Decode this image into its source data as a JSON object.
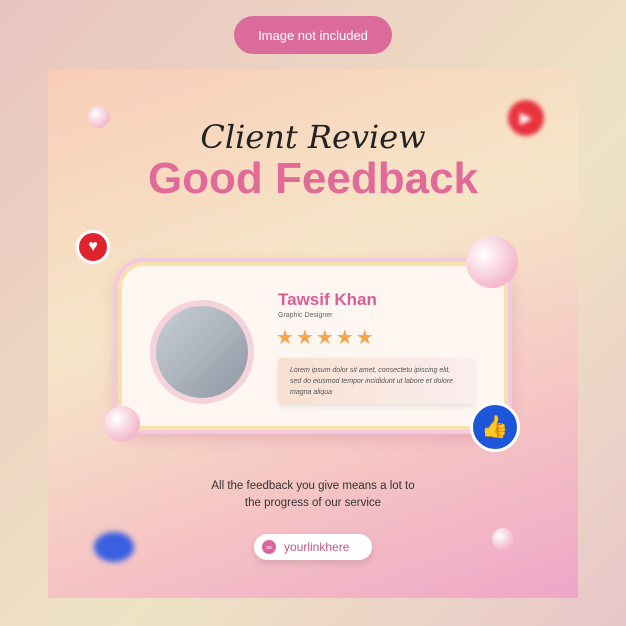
{
  "notice": "Image not included",
  "poster": {
    "script_title": "Client Review",
    "title": "Good Feedback",
    "card": {
      "name": "Tawsif Khan",
      "role": "Graphic Designer",
      "rating": 5,
      "stars": "★★★★★",
      "review": "Lorem ipsum dolor sit amet, consectetu ipiscing elit, sed do eiusmod tempor incididunt ut labore et dolore magna aliqua"
    },
    "tagline_1": "All the feedback you give means a lot to",
    "tagline_2": "the progress of our service",
    "link": "yourlinkhere",
    "icons": [
      "heart-icon",
      "thumbs-up-icon",
      "link-icon"
    ]
  }
}
